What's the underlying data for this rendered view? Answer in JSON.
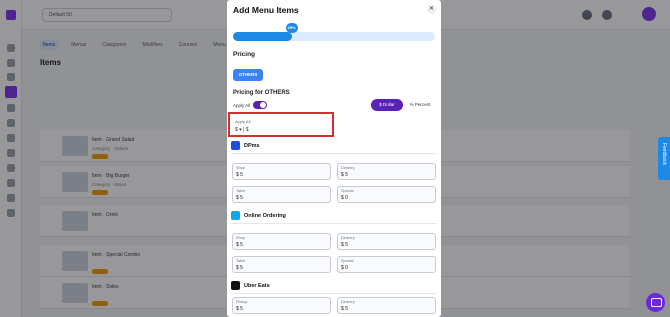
{
  "background": {
    "location_label": "Default 50",
    "tabs": [
      "Items",
      "Menus",
      "Categories",
      "Modifiers",
      "Courses",
      "Menu Settings"
    ],
    "page_title": "Items",
    "rows": [
      {
        "name": "Item · Grand Salad",
        "sub": "Category · Salads"
      },
      {
        "name": "Item · Big Burger",
        "sub": "Category · Mains"
      },
      {
        "name": "Item · Drink",
        "sub": ""
      },
      {
        "name": "Item · Special Combo",
        "sub": ""
      },
      {
        "name": "Item · Sides",
        "sub": ""
      }
    ]
  },
  "feedback_label": "Feedback",
  "modal": {
    "title": "Add Menu Items",
    "close_glyph": "✕",
    "progress_percent": 29,
    "progress_label": "29%",
    "pricing_heading": "Pricing",
    "category_button": "OTHERS",
    "pricing_for_heading": "Pricing for OTHERS",
    "apply_all_label": "Apply All",
    "apply_all_on": true,
    "mode_dollar": "$ Dollar",
    "mode_percent": "% Percent",
    "apply_all_field": {
      "label": "Apply All",
      "value": "$ ▾ | $"
    },
    "sections": [
      {
        "name": "DPms",
        "icon": "dpms-icon",
        "fields": [
          {
            "label": "Shop",
            "value": "$ 5"
          },
          {
            "label": "Delivery",
            "value": "$ 5"
          },
          {
            "label": "Table",
            "value": "$ 5"
          },
          {
            "label": "Special",
            "value": "$ 0"
          }
        ]
      },
      {
        "name": "Online Ordering",
        "icon": "online-ordering-icon",
        "fields": [
          {
            "label": "Shop",
            "value": "$ 5"
          },
          {
            "label": "Delivery",
            "value": "$ 5"
          },
          {
            "label": "Table",
            "value": "$ 5"
          },
          {
            "label": "Special",
            "value": "$ 0"
          }
        ]
      },
      {
        "name": "Uber Eats",
        "icon": "uber-eats-icon",
        "fields": [
          {
            "label": "Pickup",
            "value": "$ 5"
          },
          {
            "label": "Delivery",
            "value": "$ 5"
          }
        ]
      }
    ]
  },
  "colors": {
    "accent": "#5b21b6",
    "primary": "#1e88e5",
    "highlight": "#d32f2f"
  }
}
